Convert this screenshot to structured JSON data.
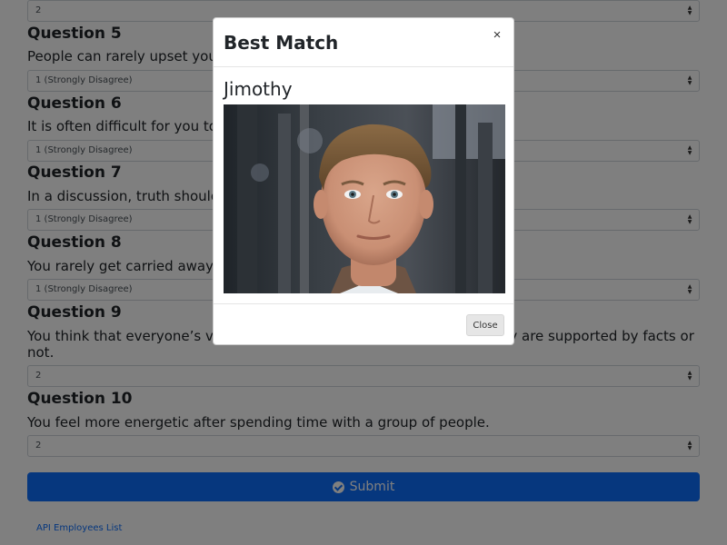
{
  "form": {
    "top_select": "2",
    "questions": [
      {
        "title": "Question 5",
        "text": "People can rarely upset you.",
        "answer": "1 (Strongly Disagree)"
      },
      {
        "title": "Question 6",
        "text": "It is often difficult for you to",
        "answer": "1 (Strongly Disagree)"
      },
      {
        "title": "Question 7",
        "text": "In a discussion, truth should",
        "answer": "1 (Strongly Disagree)"
      },
      {
        "title": "Question 8",
        "text": "You rarely get carried away b",
        "answer": "1 (Strongly Disagree)"
      },
      {
        "title": "Question 9",
        "text": "You think that everyone’s vie                                                          r they are supported by facts or not.",
        "answer": "2"
      },
      {
        "title": "Question 10",
        "text": "You feel more energetic after spending time with a group of people.",
        "answer": "2"
      }
    ],
    "submit_label": "Submit",
    "api_link": "API Employees List"
  },
  "modal": {
    "title": "Best Match",
    "close_x": "×",
    "match_name": "Jimothy",
    "close_label": "Close"
  },
  "colors": {
    "primary": "#0d6efd",
    "backdrop": "rgba(0,0,0,0.5)"
  }
}
